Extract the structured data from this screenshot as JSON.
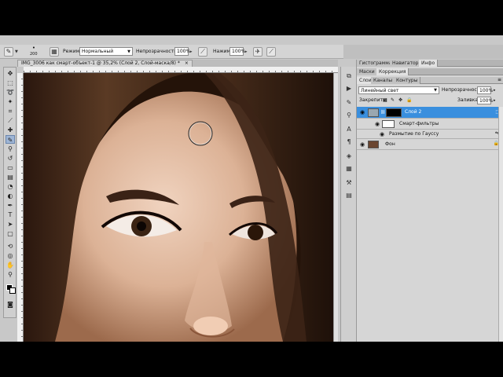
{
  "options_bar": {
    "brush_size": "200",
    "mode_label": "Режим:",
    "mode_value": "Нормальный",
    "opacity_label": "Непрозрачность:",
    "opacity_value": "100%",
    "flow_label": "Нажим:",
    "flow_value": "100%"
  },
  "document": {
    "tab_title": "IMG_3006 как смарт-объект-1 @ 35,2% (Слой 2, Слой-маска/8) *"
  },
  "panels": {
    "top_tabs": [
      "Гистограмма",
      "Навигатор",
      "Инфо"
    ],
    "mid_tabs": [
      "Маски",
      "Коррекция"
    ],
    "layer_tabs": [
      "Слои",
      "Каналы",
      "Контуры"
    ],
    "blend_mode": "Линейный свет",
    "opacity_label": "Непрозрачность:",
    "opacity_value": "100%",
    "lock_label": "Закрепить:",
    "fill_label": "Заливка:",
    "fill_value": "100%",
    "layers": [
      {
        "name": "Слой 2",
        "selected": true
      },
      {
        "name": "Смарт-фильтры"
      },
      {
        "name": "Размытие по Гауссу"
      },
      {
        "name": "Фон"
      }
    ]
  },
  "icons": {
    "brush": "brush-icon",
    "airbrush": "airbrush-icon",
    "eye": "eye-icon",
    "lock": "lock-icon"
  },
  "colors": {
    "selected_layer": "#3a8fde",
    "workspace": "#c8c8c8"
  }
}
